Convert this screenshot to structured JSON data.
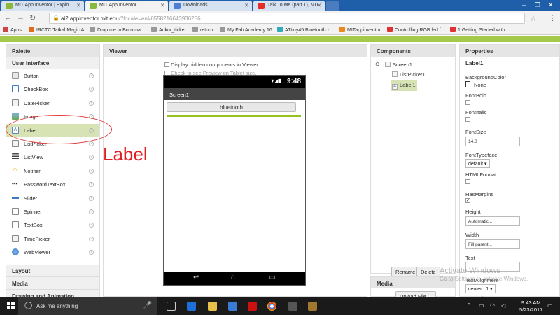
{
  "browser": {
    "tabs": [
      {
        "label": "MIT App Inventor | Explo",
        "active": false
      },
      {
        "label": "MIT App Inventor",
        "active": true
      },
      {
        "label": "Downloads",
        "active": false
      },
      {
        "label": "Talk To Me (part 1), MIT /",
        "active": false
      }
    ],
    "url_host": "ai2.appinventor.mit.edu",
    "url_path": "/?locale=en#6558216643936256",
    "bookmarks": [
      "Apps",
      "IRCTC Tatkal Magic A",
      "Drop me in Bookmar",
      "Ankur_ticket",
      "return",
      "My Fab Academy 16",
      "ATtiny45 Bluetooth -",
      "MITappinventor",
      "Controlling RGB led f",
      "1.Getting Started with"
    ]
  },
  "palette": {
    "title": "Palette",
    "category": "User Interface",
    "items": [
      "Button",
      "CheckBox",
      "DatePicker",
      "Image",
      "Label",
      "ListPicker",
      "ListView",
      "Notifier",
      "PasswordTextBox",
      "Slider",
      "Spinner",
      "TextBox",
      "TimePicker",
      "WebViewer"
    ],
    "selected": "Label",
    "more_categories": [
      "Layout",
      "Media",
      "Drawing and Animation"
    ]
  },
  "viewer": {
    "title": "Viewer",
    "checkbox_hidden": "Display hidden components in Viewer",
    "checkbox_tablet": "Check to see Preview on Tablet size.",
    "phone_time": "9:48",
    "screen_title": "Screen1",
    "button_text": "bluetooth"
  },
  "annotation": {
    "text": "Label",
    "color": "#e02020"
  },
  "components": {
    "title": "Components",
    "tree": [
      "Screen1",
      "ListPicker1",
      "Label1"
    ],
    "selected": "Label1",
    "rename": "Rename",
    "delete": "Delete",
    "media_title": "Media",
    "upload": "Upload File ..."
  },
  "properties": {
    "title": "Properties",
    "component": "Label1",
    "background_color_label": "BackgroundColor",
    "background_color_value": "None",
    "fontbold": "FontBold",
    "fontitalic": "FontItalic",
    "fontsize": "FontSize",
    "fontsize_value": "14.0",
    "fonttypeface": "FontTypeface",
    "fonttypeface_value": "default",
    "htmlformat": "HTMLFormat",
    "hasmargins": "HasMargins",
    "height": "Height",
    "height_value": "Automatic...",
    "width": "Width",
    "width_value": "Fill parent...",
    "text": "Text",
    "textalignment": "TextAlignment",
    "textalignment_value": "center : 1",
    "textcolor": "TextColor"
  },
  "watermark": {
    "line1": "Activate Windows",
    "line2": "Go to Settings to activate Windows."
  },
  "taskbar": {
    "search_placeholder": "Ask me anything",
    "time": "9:43 AM",
    "date": "5/23/2017"
  },
  "colors": {
    "accent_green": "#a4c94b",
    "selection": "#d8e3b5",
    "chrome_blue": "#1f5fa9"
  }
}
